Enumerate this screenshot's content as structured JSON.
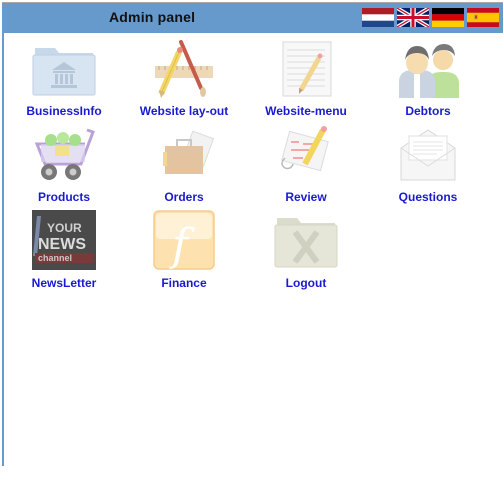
{
  "header": {
    "title": "Admin panel",
    "background": "#6699cc",
    "languages": [
      {
        "name": "Dutch",
        "icon": "flag-nl-icon"
      },
      {
        "name": "English",
        "icon": "flag-uk-icon"
      },
      {
        "name": "German",
        "icon": "flag-de-icon"
      },
      {
        "name": "Spanish",
        "icon": "flag-es-icon"
      }
    ]
  },
  "menu": {
    "label_color": "#1a1ad0",
    "items": [
      {
        "label": "BusinessInfo",
        "icon": "business-folder-icon"
      },
      {
        "label": "Website lay-out",
        "icon": "design-tools-icon"
      },
      {
        "label": "Website-menu",
        "icon": "notepad-pencil-icon"
      },
      {
        "label": "Debtors",
        "icon": "users-icon"
      },
      {
        "label": "Products",
        "icon": "shopping-cart-icon"
      },
      {
        "label": "Orders",
        "icon": "briefcase-icon"
      },
      {
        "label": "Review",
        "icon": "document-edit-icon"
      },
      {
        "label": "Questions",
        "icon": "envelope-icon"
      },
      {
        "label": "NewsLetter",
        "icon": "news-channel-icon"
      },
      {
        "label": "Finance",
        "icon": "finance-f-icon"
      },
      {
        "label": "Logout",
        "icon": "logout-folder-icon"
      }
    ]
  }
}
